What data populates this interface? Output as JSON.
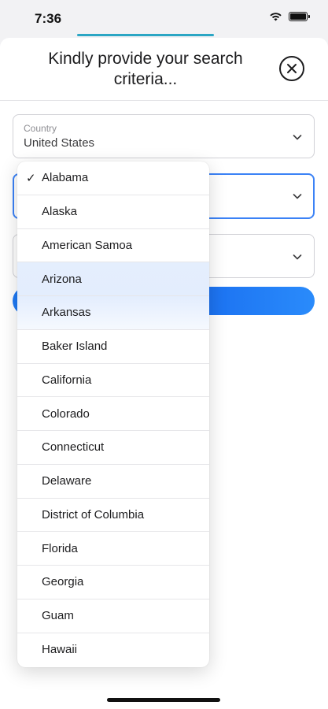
{
  "status_bar": {
    "time": "7:36"
  },
  "sheet": {
    "title": "Kindly provide your search criteria...",
    "close_icon": "close-circle-icon"
  },
  "form": {
    "country": {
      "label": "Country",
      "value": "United States"
    },
    "state": {
      "value": ""
    },
    "city": {
      "value": ""
    },
    "search_button": {
      "label": ""
    }
  },
  "state_dropdown": {
    "selected": "Alabama",
    "options": [
      "Alabama",
      "Alaska",
      "American Samoa",
      "Arizona",
      "Arkansas",
      "Baker Island",
      "California",
      "Colorado",
      "Connecticut",
      "Delaware",
      "District of Columbia",
      "Florida",
      "Georgia",
      "Guam",
      "Hawaii"
    ]
  },
  "colors": {
    "accent": "#1f7af5",
    "focus_border": "#3b82f6",
    "handle": "#2ba6c4"
  }
}
